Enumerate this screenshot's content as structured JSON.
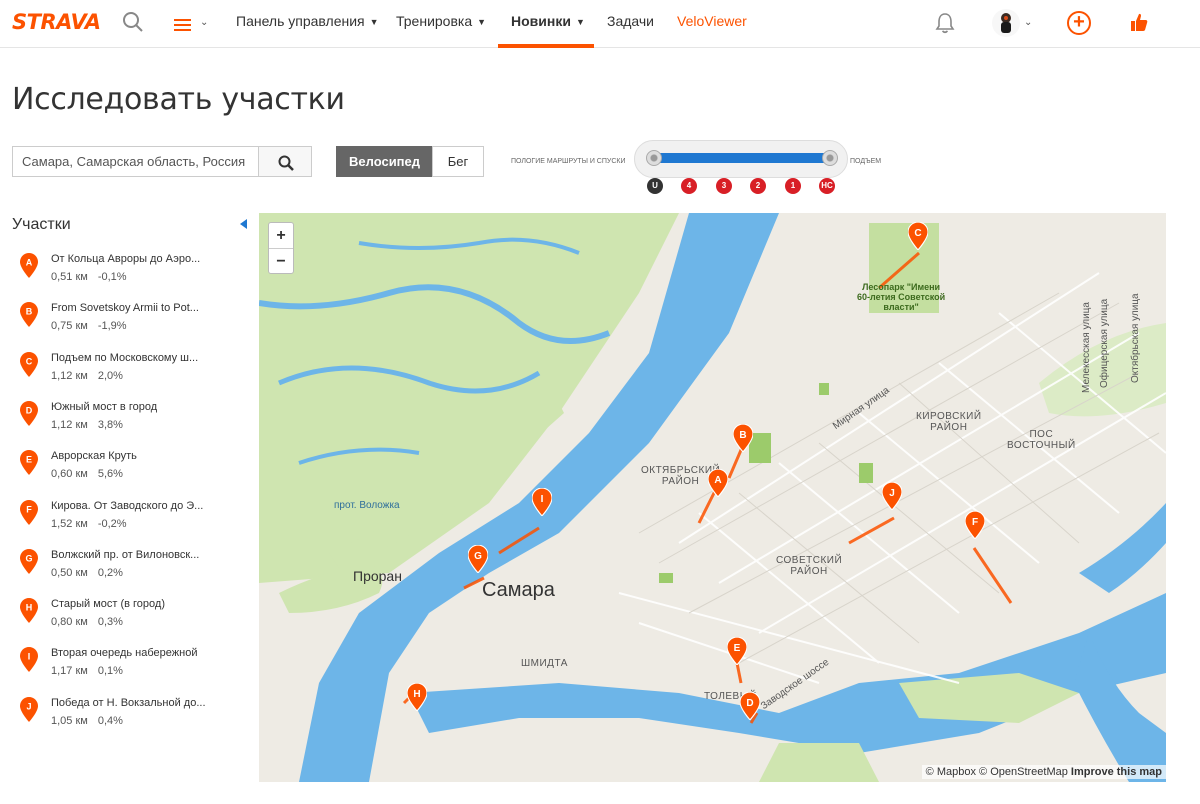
{
  "nav": {
    "logo": "STRAVA",
    "links": [
      {
        "label": "Панель управления",
        "caret": true
      },
      {
        "label": "Тренировка",
        "caret": true
      },
      {
        "label": "Новинки",
        "caret": true
      },
      {
        "label": "Задачи",
        "caret": false
      },
      {
        "label": "VeloViewer",
        "caret": false
      }
    ],
    "plus": "+"
  },
  "page_title": "Исследовать участки",
  "search": {
    "value": "Самара, Самарская область, Россия"
  },
  "sport_toggle": {
    "bike": "Велосипед",
    "run": "Бег"
  },
  "climb_filter": {
    "left_label": "пологие маршруты и спуски",
    "right_label": "подъем",
    "categories": [
      "U",
      "4",
      "3",
      "2",
      "1",
      "HC"
    ]
  },
  "sidebar": {
    "title": "Участки",
    "segments": [
      {
        "letter": "A",
        "name": "От Кольца Авроры до Аэро...",
        "distance": "0,51 км",
        "grade": "-0,1%"
      },
      {
        "letter": "B",
        "name": "From Sovetskoy Armii to Pot...",
        "distance": "0,75 км",
        "grade": "-1,9%"
      },
      {
        "letter": "C",
        "name": "Подъем по Московскому ш...",
        "distance": "1,12 км",
        "grade": "2,0%"
      },
      {
        "letter": "D",
        "name": "Южный мост в город",
        "distance": "1,12 км",
        "grade": "3,8%"
      },
      {
        "letter": "E",
        "name": "Аврорская Круть",
        "distance": "0,60 км",
        "grade": "5,6%"
      },
      {
        "letter": "F",
        "name": "Кирова. От Заводского до Э...",
        "distance": "1,52 км",
        "grade": "-0,2%"
      },
      {
        "letter": "G",
        "name": "Волжский пр. от Вилоновск...",
        "distance": "0,50 км",
        "grade": "0,2%"
      },
      {
        "letter": "H",
        "name": "Старый мост (в город)",
        "distance": "0,80 км",
        "grade": "0,3%"
      },
      {
        "letter": "I",
        "name": "Вторая очередь набережной",
        "distance": "1,17 км",
        "grade": "0,1%"
      },
      {
        "letter": "J",
        "name": "Победа от Н. Вокзальной до...",
        "distance": "1,05 км",
        "grade": "0,4%"
      }
    ]
  },
  "map": {
    "zoom_in": "+",
    "zoom_out": "−",
    "labels": {
      "city": "Самара",
      "island": "Проран",
      "volozhka": "прот. Воложка",
      "park_line1": "Лесопарк \"Имени",
      "park_line2": "60-летия Советской",
      "park_line3": "власти\"",
      "oktyabr1": "ОКТЯБРЬСКИЙ",
      "oktyabr2": "РАЙОН",
      "kirov1": "КИРОВСКИЙ",
      "kirov2": "РАЙОН",
      "vostoch1": "ПОС",
      "vostoch2": "ВОСТОЧНЫЙ",
      "sovet1": "СОВЕТСКИЙ",
      "sovet2": "РАЙОН",
      "shmidta": "ШМИДТА",
      "tolevyi": "ТОЛЕВЫЙ",
      "mirnaya": "Мирная улица",
      "zavodskoe": "Заводское шоссе",
      "melekess": "Мелекесская улица",
      "ofitser": "Офицерская улица",
      "oktyabr_st": "Октябрьская улица"
    },
    "attribution": {
      "mapbox": "© Mapbox",
      "osm": "© OpenStreetMap",
      "improve": "Improve this map"
    }
  },
  "colors": {
    "brand": "#fc5200",
    "water": "#6db5e8",
    "green": "#c9e4a3",
    "land": "#eeebe4",
    "category": "#d81f26",
    "slider": "#1f78d1"
  }
}
